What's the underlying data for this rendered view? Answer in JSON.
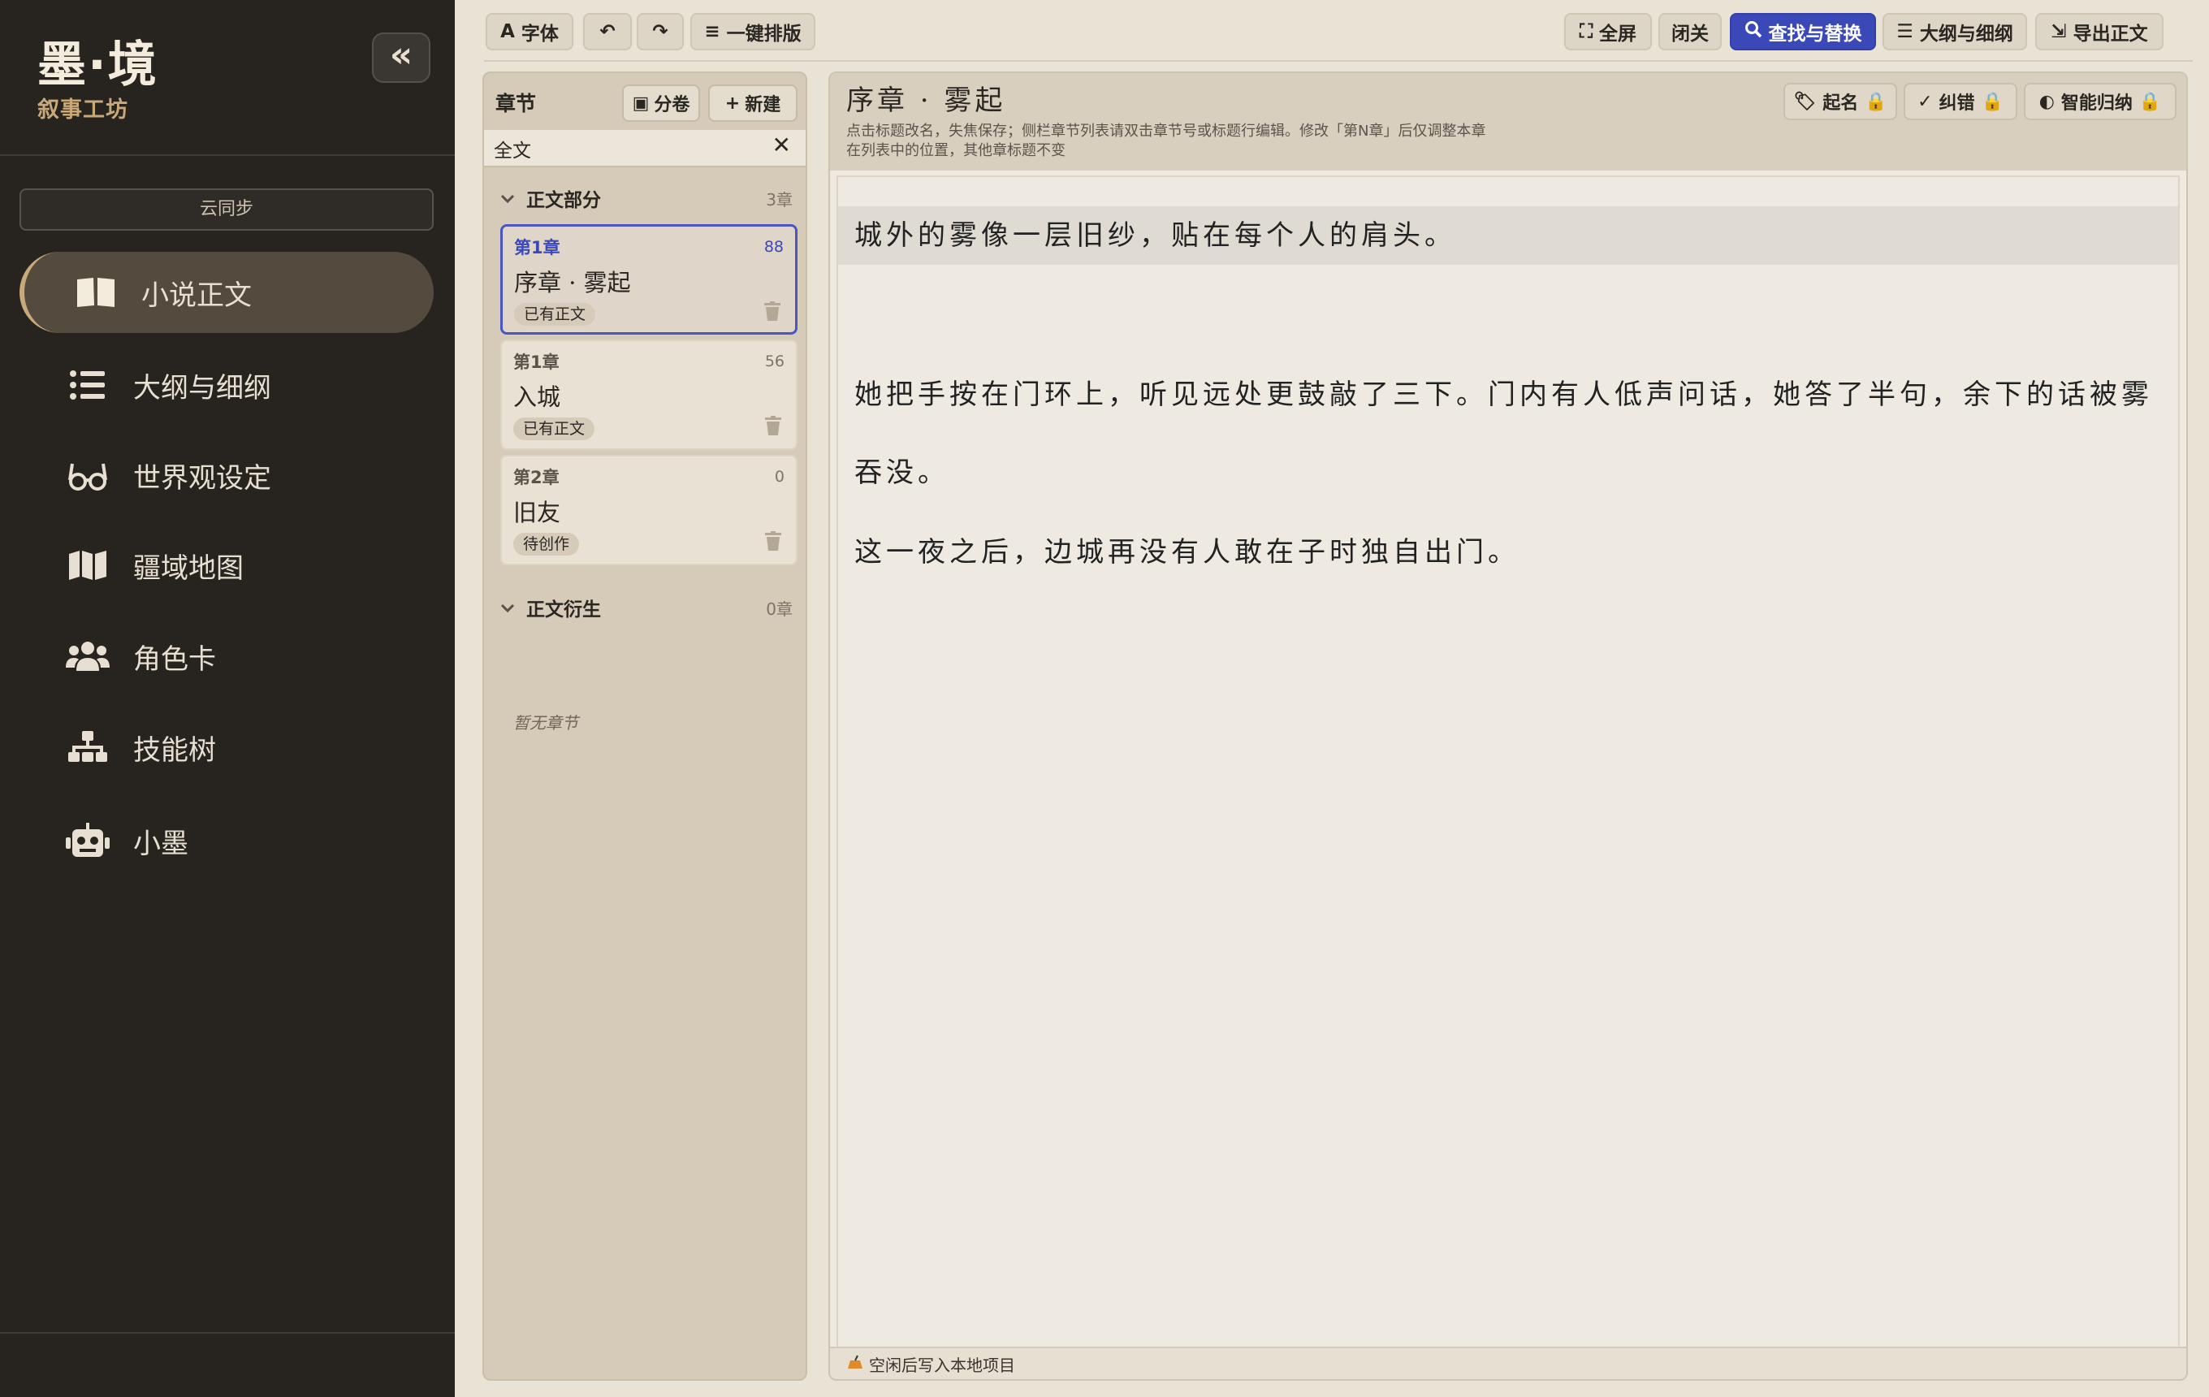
{
  "sidebar": {
    "brand_title": "墨·境",
    "brand_subtitle": "叙事工坊",
    "collapse_label": "«",
    "cloud_sync": "云同步",
    "items": [
      {
        "label": "小说正文",
        "icon": "book-open-icon"
      },
      {
        "label": "大纲与细纲",
        "icon": "list-icon"
      },
      {
        "label": "世界观设定",
        "icon": "glasses-icon"
      },
      {
        "label": "疆域地图",
        "icon": "map-icon"
      },
      {
        "label": "角色卡",
        "icon": "users-icon"
      },
      {
        "label": "技能树",
        "icon": "sitemap-icon"
      },
      {
        "label": "小墨",
        "icon": "robot-icon"
      }
    ]
  },
  "toolbar": {
    "font": "字体",
    "undo": "↶",
    "redo": "↷",
    "auto_format": "一键排版",
    "fullscreen": "全屏",
    "focus": "闭关",
    "find_replace": "查找与替换",
    "outline": "大纲与细纲",
    "export": "导出正文"
  },
  "chapters": {
    "title": "章节",
    "split_volume": "分卷",
    "new": "新建",
    "filter": "全文",
    "clear": "✕",
    "group_main": {
      "name": "正文部分",
      "count": "3章"
    },
    "group_derived": {
      "name": "正文衍生",
      "count": "0章"
    },
    "empty": "暂无章节",
    "items": [
      {
        "num": "第1章",
        "name": "序章 · 雾起",
        "count": "88",
        "status": "已有正文",
        "active": true
      },
      {
        "num": "第1章",
        "name": "入城",
        "count": "56",
        "status": "已有正文",
        "active": false
      },
      {
        "num": "第2章",
        "name": "旧友",
        "count": "0",
        "status": "待创作",
        "active": false
      }
    ]
  },
  "editor": {
    "title": "序章 · 雾起",
    "hint": "点击标题改名，失焦保存；侧栏章节列表请双击章节号或标题行编辑。修改「第N章」后仅调整本章在列表中的位置，其他章标题不变",
    "actions": {
      "naming": "起名",
      "proofread": "纠错",
      "summarize": "智能归纳"
    },
    "paragraphs": [
      "城外的雾像一层旧纱，贴在每个人的肩头。",
      "她把手按在门环上，听见远处更鼓敲了三下。门内有人低声问话，她答了半句，余下的话被雾吞没。",
      "这一夜之后，边城再没有人敢在子时独自出门。"
    ],
    "footer": "空闲后写入本地项目"
  },
  "colors": {
    "sidebar_bg": "#272420",
    "accent_gold": "#c9a979",
    "primary_blue": "#3b49b8"
  }
}
